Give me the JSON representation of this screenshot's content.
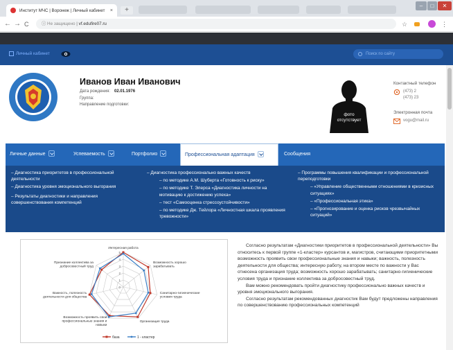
{
  "browser": {
    "tab_title": "Институт МЧС | Воронеж | Личный кабинет",
    "tab_close": "×",
    "new_tab": "+",
    "url_security": "Не защищено",
    "url_domain": "vf.edufire07.ru"
  },
  "header": {
    "cabinet_label": "Личный кабинет",
    "search_placeholder": "Поиск по сайту"
  },
  "profile": {
    "name": "Иванов Иван Иванович",
    "birth_label": "Дата рождения:",
    "birth_value": "02.01.1976",
    "group_label": "Группа:",
    "direction_label": "Направление подготовки:",
    "photo_text_1": "фото",
    "photo_text_2": "отсутствует",
    "phone_label": "Контактный телефон",
    "phone_1": "(473) 2",
    "phone_2": "(473) 23",
    "email_label": "Электронная почта",
    "email_value": "vogu@mail.ru"
  },
  "nav": {
    "tabs": [
      {
        "label": "Личные данные"
      },
      {
        "label": "Успеваемость"
      },
      {
        "label": "Портфолио"
      },
      {
        "label": "Профессиональная адаптация"
      },
      {
        "label": "Сообщения"
      }
    ]
  },
  "dropdown": {
    "col1": [
      "– Диагностика приоритетов в профессиональной деятельности",
      "– Диагностика уровня эмоционального выгорания",
      "– Результаты диагностики и направления совершенствования компетенций"
    ],
    "col2_head": "– Диагностика профессионально важных качеств",
    "col2": [
      "– по методике А.М. Шуберта «Готовность к риску»",
      "– по методике Т. Элерса «Диагностика личности на мотивацию к достижению успеха»",
      "– тест «Самооценка стрессоустойчивости»",
      "– по методике Дж. Тейлора «Личностная шкала проявления тревожности»"
    ],
    "col3_head": "– Программы повышения квалификации и профессиональной переподготовки",
    "col3": [
      "– «Управление общественными отношениями в кризисных ситуациях»",
      "– «Профессиональная этика»",
      "– «Прогнозирование и оценка рисков чрезвычайных ситуаций»"
    ]
  },
  "content": {
    "paragraphs": [
      "Согласно результатам «Диагностики приоритетов в профессиональной деятельности» Вы относитесь к первой группе «1-кластер» курсантов и, магистров, считающими приоритетными возможность проявить свои профессиональные знания и навыки; важность, полезность деятельности для общества; интересную работу, на втором месте по важности у Вас отнесена организация труда; возможность хорошо зарабатывать; санитарно-гигиенические условия труда и признание коллектива за добросовестный труд.",
      "Вам можно рекомендовать пройти диагностику профессионально важных качеств и уровня эмоционального выгорания.",
      "Согласно результатам рекомендованных диагностик Вам будут предложены направления по совершенствованию профессиональных компетенций"
    ]
  },
  "chart_data": {
    "type": "radar",
    "categories": [
      "Интересная работа",
      "Возможность хорошо зарабатывать",
      "Санитарно-гигиенические условия труда",
      "Организация труда",
      "Возможность проявить свои профессиональные знания и навыки",
      "Важность, полезность деятельности для общества",
      "Признание коллектива за добросовестный труд"
    ],
    "rticks": [
      "0",
      "1",
      "2",
      "3",
      "4",
      "5"
    ],
    "rmax": 5,
    "series": [
      {
        "name": "база",
        "color": "#c0392b",
        "values": [
          5,
          4.6,
          4,
          4.8,
          4.6,
          5,
          4
        ]
      },
      {
        "name": "1 - кластер",
        "color": "#3a7fc6",
        "values": [
          4.8,
          3.8,
          3.7,
          4.2,
          4.8,
          4.7,
          4.3
        ]
      }
    ]
  }
}
